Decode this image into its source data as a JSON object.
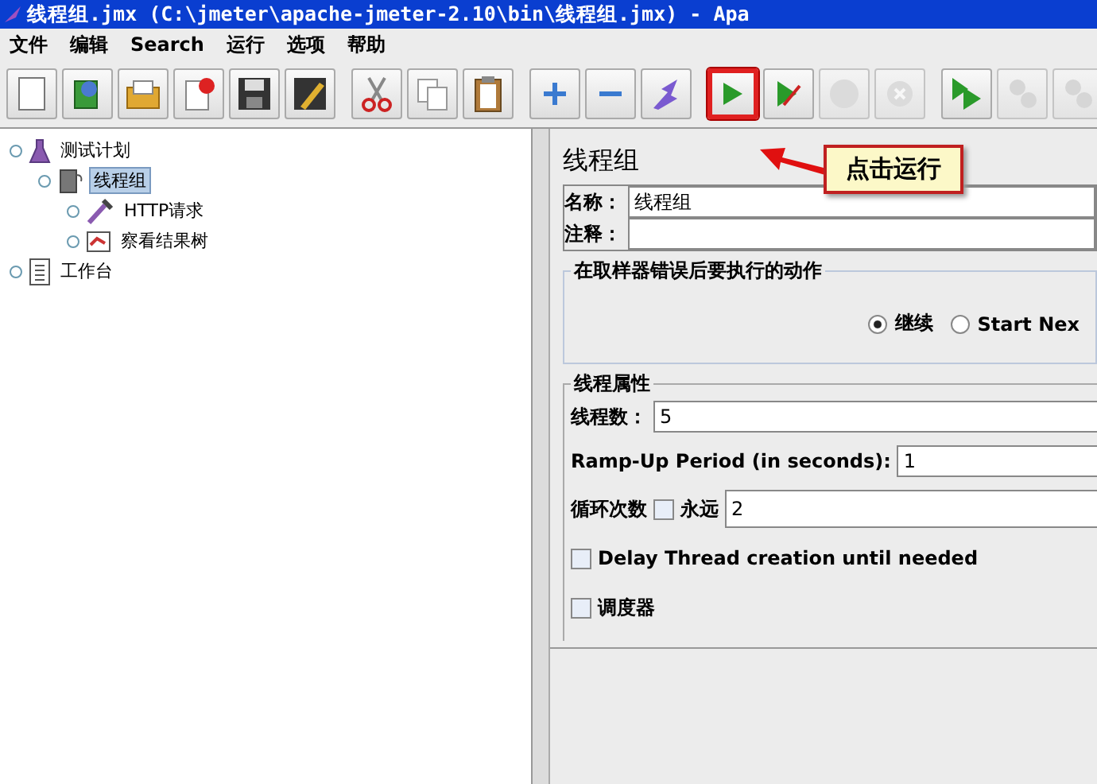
{
  "window": {
    "title": "线程组.jmx (C:\\jmeter\\apache-jmeter-2.10\\bin\\线程组.jmx) - Apa"
  },
  "menu": [
    "文件",
    "编辑",
    "Search",
    "运行",
    "选项",
    "帮助"
  ],
  "toolbar": [
    [
      {
        "kind": "new",
        "disabled": false,
        "highlighted": false
      },
      {
        "kind": "templates",
        "disabled": false,
        "highlighted": false
      },
      {
        "kind": "open",
        "disabled": false,
        "highlighted": false
      },
      {
        "kind": "close",
        "disabled": false,
        "highlighted": false
      },
      {
        "kind": "save",
        "disabled": false,
        "highlighted": false
      },
      {
        "kind": "save-as",
        "disabled": false,
        "highlighted": false
      }
    ],
    [
      {
        "kind": "cut",
        "disabled": false,
        "highlighted": false
      },
      {
        "kind": "copy",
        "disabled": false,
        "highlighted": false
      },
      {
        "kind": "paste",
        "disabled": false,
        "highlighted": false
      }
    ],
    [
      {
        "kind": "expand",
        "disabled": false,
        "highlighted": false
      },
      {
        "kind": "collapse",
        "disabled": false,
        "highlighted": false
      },
      {
        "kind": "toggle",
        "disabled": false,
        "highlighted": false
      }
    ],
    [
      {
        "kind": "start",
        "disabled": false,
        "highlighted": true
      },
      {
        "kind": "start-no-pause",
        "disabled": false,
        "highlighted": false
      },
      {
        "kind": "stop",
        "disabled": true,
        "highlighted": false
      },
      {
        "kind": "shutdown",
        "disabled": true,
        "highlighted": false
      }
    ],
    [
      {
        "kind": "remote-start",
        "disabled": false,
        "highlighted": false
      },
      {
        "kind": "remote-stop",
        "disabled": true,
        "highlighted": false
      },
      {
        "kind": "remote-shutdown",
        "disabled": true,
        "highlighted": false
      }
    ]
  ],
  "callout": {
    "text": "点击运行"
  },
  "tree": [
    {
      "label": "测试计划",
      "kind": "plan",
      "selected": false,
      "children": [
        {
          "label": "线程组",
          "kind": "threads",
          "selected": true,
          "children": [
            {
              "label": "HTTP请求",
              "kind": "sampler",
              "selected": false
            },
            {
              "label": "察看结果树",
              "kind": "listener",
              "selected": false
            }
          ]
        }
      ]
    },
    {
      "label": "工作台",
      "kind": "workbench",
      "selected": false
    }
  ],
  "panel": {
    "title": "线程组",
    "name": {
      "label": "名称：",
      "value": "线程组"
    },
    "comment": {
      "label": "注释："
    },
    "error_action": {
      "title": "在取样器错误后要执行的动作",
      "options": [
        {
          "label": "继续",
          "selected": true
        },
        {
          "label": "Start Nex",
          "selected": false
        }
      ]
    },
    "thread_props": {
      "title": "线程属性",
      "threads": {
        "label": "线程数：",
        "value": "5"
      },
      "rampup": {
        "label": "Ramp-Up Period (in seconds):",
        "value": "1"
      },
      "loop": {
        "label": "循环次数",
        "forever_label": "永远",
        "forever": false,
        "value": "2"
      },
      "delay": {
        "label": "Delay Thread creation until needed",
        "checked": false
      },
      "scheduler": {
        "label": "调度器",
        "checked": false
      }
    }
  }
}
